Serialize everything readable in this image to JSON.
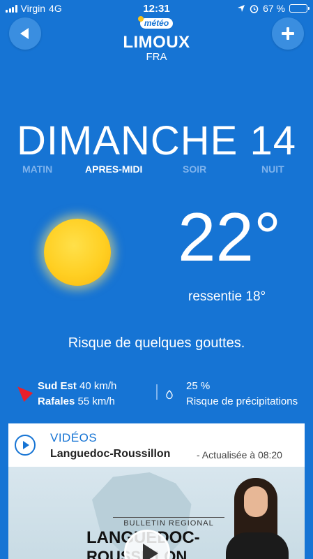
{
  "status_bar": {
    "carrier": "Virgin",
    "network": "4G",
    "time": "12:31",
    "battery": "67 %",
    "battery_level": 0.67
  },
  "header": {
    "logo_text": "météo",
    "city": "LIMOUX",
    "country": "FRA"
  },
  "day": {
    "title": "DIMANCHE 14",
    "periods": [
      {
        "label": "MATIN",
        "active": false
      },
      {
        "label": "APRES-MIDI",
        "active": true
      },
      {
        "label": "SOIR",
        "active": false
      },
      {
        "label": "NUIT",
        "active": false
      }
    ]
  },
  "weather": {
    "icon": "sun-icon",
    "temperature": "22°",
    "feels_like_label": "ressentie",
    "feels_like": "18°",
    "description": "Risque de quelques gouttes.",
    "wind_direction": "Sud Est",
    "wind_speed": "40 km/h",
    "gusts_label": "Rafales",
    "gusts_speed": "55 km/h",
    "precip_percent": "25 %",
    "precip_label": "Risque de précipitations"
  },
  "videos": {
    "title": "VIDÉOS",
    "region": "Languedoc-Roussillon",
    "updated": "- Actualisée à 08:20",
    "thumbnail": {
      "caption": "BULLETIN REGIONAL",
      "headline_1": "LANGUEDOC-",
      "headline_2": "ROUSSILLON"
    }
  },
  "colors": {
    "background": "#1674d4",
    "inactive_period": "#7fb3ec",
    "wind_arrow": "#e8202a",
    "sun": "#ffcf22"
  }
}
